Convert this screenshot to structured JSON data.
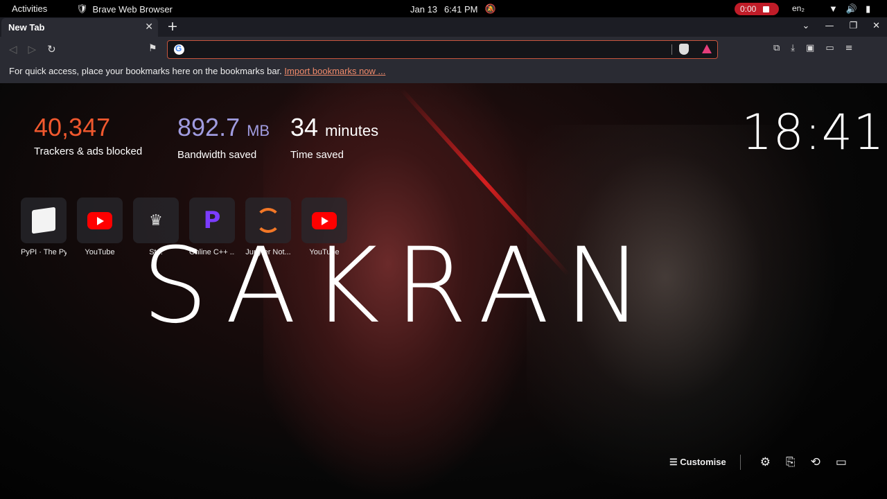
{
  "topbar": {
    "activities": "Activities",
    "app_name": "Brave Web Browser",
    "date": "Jan 13",
    "time": "6:41 PM",
    "recording": "0:00",
    "language": "en₂"
  },
  "tabs": [
    {
      "label": "New Tab"
    }
  ],
  "bookmarks_bar": {
    "text": "For quick access, place your bookmarks here on the bookmarks bar.",
    "link": "Import bookmarks now ..."
  },
  "stats": {
    "trackers": {
      "value": "40,347",
      "label": "Trackers & ads blocked"
    },
    "bandwidth": {
      "value": "892.7",
      "unit": "MB",
      "label": "Bandwidth saved"
    },
    "time": {
      "value": "34",
      "unit": "minutes",
      "label": "Time saved"
    }
  },
  "clock": "18:41",
  "top_sites": [
    {
      "name": "PyPI · The Py...",
      "icon": "pypi-icon"
    },
    {
      "name": "YouTube",
      "icon": "youtube-icon"
    },
    {
      "name": "St...",
      "icon": "crown-icon"
    },
    {
      "name": "Online C++ ...",
      "icon": "programiz-icon"
    },
    {
      "name": "Jupyter Not...",
      "icon": "jupyter-icon"
    },
    {
      "name": "YouTube",
      "icon": "youtube-icon"
    }
  ],
  "background_title": "SAKRAN",
  "customise": "Customise"
}
